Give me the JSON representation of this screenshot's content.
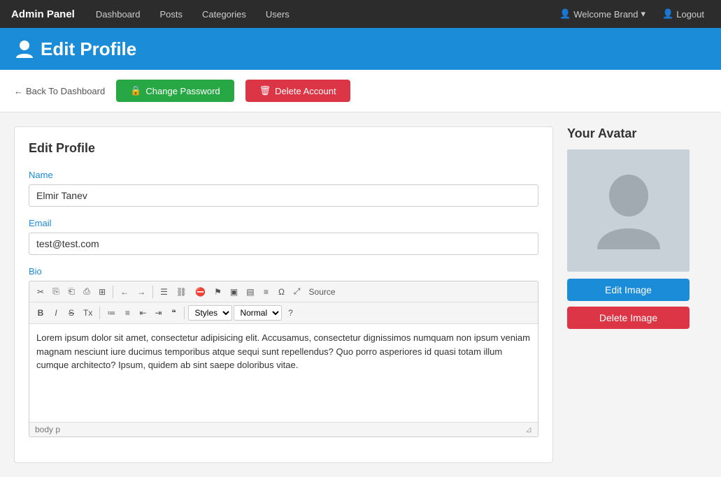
{
  "navbar": {
    "brand": "Admin Panel",
    "links": [
      "Dashboard",
      "Posts",
      "Categories",
      "Users"
    ],
    "user_label": "Welcome Brand",
    "logout_label": "Logout"
  },
  "page_header": {
    "title": "Edit Profile"
  },
  "action_bar": {
    "back_label": "Back To Dashboard",
    "change_password_label": "Change Password",
    "delete_account_label": "Delete Account"
  },
  "edit_profile_card": {
    "title": "Edit Profile",
    "name_label": "Name",
    "name_value": "Elmir Tanev",
    "email_label": "Email",
    "email_value": "test@test.com",
    "bio_label": "Bio",
    "bio_content": "Lorem ipsum dolor sit amet, consectetur adipisicing elit. Accusamus, consectetur dignissimos numquam non ipsum veniam magnam nesciunt iure ducimus temporibus atque sequi sunt repellendus? Quo porro asperiores id quasi totam illum cumque architecto? Ipsum, quidem ab sint saepe doloribus vitae.",
    "editor_footer": "body  p",
    "toolbar": {
      "row1": [
        "✂",
        "⎘",
        "⎗",
        "⎙",
        "⊞",
        "←",
        "→",
        "☰",
        "⛓",
        "⛔",
        "⚑",
        "▣",
        "▤",
        "≡",
        "Ω",
        "⤢",
        "Source"
      ],
      "row2": [
        "B",
        "I",
        "S",
        "Tx",
        "≔",
        "≡",
        "⇤",
        "⇥",
        "❝",
        "?"
      ],
      "styles_default": "Styles",
      "format_default": "Normal"
    }
  },
  "avatar_section": {
    "title": "Your Avatar",
    "edit_image_label": "Edit Image",
    "delete_image_label": "Delete Image"
  }
}
